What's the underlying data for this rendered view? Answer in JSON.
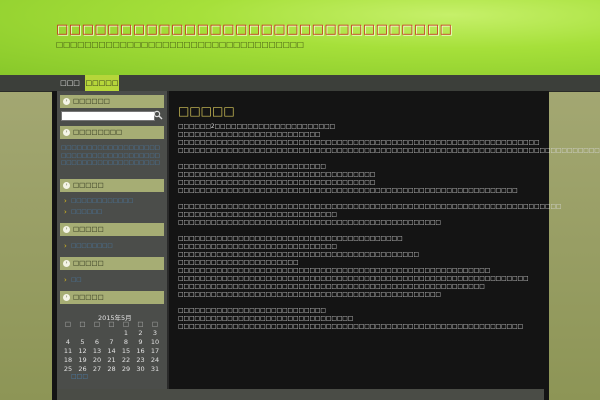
{
  "header": {
    "title": "□□□□□□□□□□□□□□□□□□□□□□□□□□□□□□□",
    "tagline": "□□□□□□□□□□□□□□□□□□□□□□□□□□□□□□□□□□□"
  },
  "nav": {
    "items": [
      {
        "label": "□□□",
        "active": false
      },
      {
        "label": "□□□□□",
        "active": true
      }
    ]
  },
  "sidebar": {
    "widgets": {
      "w1": "□□□□□□",
      "w2": "□□□□□□□□",
      "w3": "□□□□□",
      "w4": "□□□□□",
      "w5": "□□□□□",
      "w6": "□□□□□"
    },
    "search": {
      "value": "",
      "placeholder": ""
    },
    "news_text": "□□□□□□□□□□□□□□□□□□□□□□□□□□□□□□□□□□□□□□□□□□□□□□□□□□□□□□□□□",
    "list1": [
      "□□□□□□□□□□□□",
      "□□□□□□"
    ],
    "list2": [
      "□□□□□□□□"
    ],
    "list3": [
      "□□"
    ]
  },
  "calendar": {
    "caption": "2015年5月",
    "weekdays": [
      "□",
      "□",
      "□",
      "□",
      "□",
      "□",
      "□"
    ],
    "weeks": [
      [
        "",
        "",
        "",
        "",
        "1",
        "2",
        "3"
      ],
      [
        "4",
        "5",
        "6",
        "7",
        "8",
        "9",
        "10"
      ],
      [
        "11",
        "12",
        "13",
        "14",
        "15",
        "16",
        "17"
      ],
      [
        "18",
        "19",
        "20",
        "21",
        "22",
        "23",
        "24"
      ],
      [
        "25",
        "26",
        "27",
        "28",
        "29",
        "30",
        "31"
      ]
    ],
    "more": "□□□"
  },
  "post": {
    "title": "□□□□□",
    "lines": [
      "□□□□□□2□□□□□□□□□□□□□□□□□□□□□□",
      "□□□□□□□□□□□□□□□□□□□□□□□□□□",
      "□□□□□□□□□□□□□□□□□□□□□□□□□□□□□□□□□□□□□□□□□□□□□□□□□□□□□□□□□□□□□□□□□□",
      "□□□□□□□□□□□□□□□□□□□□□□□□□□□□□□□□□□□□□□□□□□□□□□□□□□□□□□□□□□□□□□□□□□□□□□□□□□□□□",
      "",
      "□□□□□□□□□□□□□□□□□□□□□□□□□□□",
      "□□□□□□□□□□□□□□□□□□□□□□□□□□□□□□□□□□□□",
      "□□□□□□□□□□□□□□□□□□□□□□□□□□□□□□□□□□□□",
      "□□□□□□□□□□□□□□□□□□□□□□□□□□□□□□□□□□□□□□□□□□□□□□□□□□□□□□□□□□□□□□",
      "",
      "□□□□□□□□□□□□□□□□□□□□□□□□□□□□□□□□□□□□□□□□□□□□□□□□□□□□□□□□□□□□□□□□□□□□□□",
      "□□□□□□□□□□□□□□□□□□□□□□□□□□□□□",
      "□□□□□□□□□□□□□□□□□□□□□□□□□□□□□□□□□□□□□□□□□□□□□□□□",
      "",
      "□□□□□□□□□□□□□□□□□□□□□□□□□□□□□□□□□□□□□□□□□",
      "□□□□□□□□□□□□□□□□□□□□□□□□□□□□□",
      "□□□□□□□□□□□□□□□□□□□□□□□□□□□□□□□□□□□□□□□□□□□□",
      "□□□□□□□□□□□□□□□□□□□□□□",
      "□□□□□□□□□□□□□□□□□□□□□□□□□□□□□□□□□□□□□□□□□□□□□□□□□□□□□□□□□",
      "□□□□□□□□□□□□□□□□□□□□□□□□□□□□□□□□□□□□□□□□□□□□□□□□□□□□□□□□□□□□□□□□",
      "□□□□□□□□□□□□□□□□□□□□□□□□□□□□□□□□□□□□□□□□□□□□□□□□□□□□□□□□",
      "□□□□□□□□□□□□□□□□□□□□□□□□□□□□□□□□□□□□□□□□□□□□□□□□",
      "",
      "□□□□□□□□□□□□□□□□□□□□□□□□□□□",
      "□□□□□□□□□□□□□□□□□□□□□□□□□□□□□□□□",
      "□□□□□□□□□□□□□□□□□□□□□□□□□□□□□□□□□□□□□□□□□□□□□□□□□□□□□□□□□□□□□□□"
    ]
  },
  "colors": {
    "header_green": "#a6e03a",
    "title_red": "#c8281e",
    "nav_active": "#b6d63a",
    "widget_head": "#a6ad74",
    "link_blue": "#4a7fb0",
    "post_title": "#d8c85a"
  }
}
